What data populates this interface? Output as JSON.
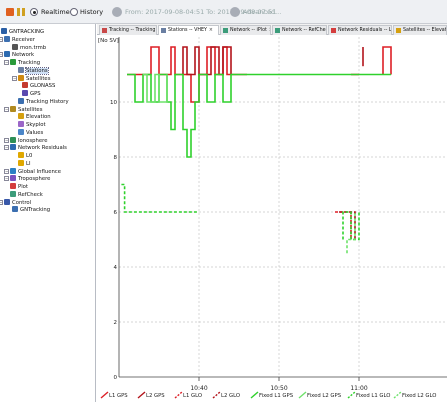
{
  "toolbar": {
    "realtime_label": "Realtime",
    "history_label": "History",
    "from_text": "From: 2017-09-08-04:51 To: 2017-09-08-07:51",
    "advanced_label": "Advanced..."
  },
  "tree": {
    "items": [
      {
        "label": "GNTRACKING",
        "icon": "app-icon"
      },
      {
        "label": "Receiver",
        "icon": "receiver-icon"
      },
      {
        "label": "mon.trmb",
        "icon": "monitor-icon"
      },
      {
        "label": "Network",
        "icon": "network-icon"
      },
      {
        "label": "Tracking",
        "icon": "tracking-icon"
      },
      {
        "label": "Stations",
        "icon": "stations-icon"
      },
      {
        "label": "Satellites",
        "icon": "satellite-icon"
      },
      {
        "label": "GLONASS",
        "icon": "glonass-icon"
      },
      {
        "label": "GPS",
        "icon": "gps-icon"
      },
      {
        "label": "Tracking History",
        "icon": "history-icon"
      },
      {
        "label": "Satellites",
        "icon": "satellite-icon"
      },
      {
        "label": "Elevation",
        "icon": "elevation-icon"
      },
      {
        "label": "Skyplot",
        "icon": "skyplot-icon"
      },
      {
        "label": "Values",
        "icon": "values-icon"
      },
      {
        "label": "Ionosphere",
        "icon": "ionosphere-icon"
      },
      {
        "label": "Network Residuals",
        "icon": "residuals-icon"
      },
      {
        "label": "L0",
        "icon": "chart-icon"
      },
      {
        "label": "LI",
        "icon": "chart-icon"
      },
      {
        "label": "Global Influence",
        "icon": "globe-icon"
      },
      {
        "label": "Troposphere",
        "icon": "troposphere-icon"
      },
      {
        "label": "Plot",
        "icon": "plot-icon"
      },
      {
        "label": "RefCheck",
        "icon": "refcheck-icon"
      },
      {
        "label": "Control",
        "icon": "control-icon"
      },
      {
        "label": "GNTracking",
        "icon": "tracking-icon"
      }
    ]
  },
  "tabs": [
    {
      "label": "Tracking -- Tracking History",
      "icon": "chart-icon"
    },
    {
      "label": "Stations -- VHEY",
      "icon": "stations-icon"
    },
    {
      "label": "Network -- iPlot",
      "icon": "plot-icon"
    },
    {
      "label": "Network -- RefCheck",
      "icon": "refcheck-icon"
    },
    {
      "label": "Network Residuals -- LO",
      "icon": "chart-icon"
    },
    {
      "label": "Satellites -- Elevation",
      "icon": "elevation-icon"
    }
  ],
  "colors": {
    "red": "#dd1f26",
    "green": "#2fd12c",
    "dark_red": "#b3141b",
    "grid": "#c7c7c7"
  },
  "chart_data": {
    "type": "line",
    "ylabel": "[No SV]",
    "ylim": [
      0,
      12
    ],
    "yticks": [
      0,
      2,
      4,
      6,
      8,
      10
    ],
    "x_range": [
      "10:30",
      "11:11"
    ],
    "x_ticks": [
      "10:40",
      "10:50",
      "11:00"
    ],
    "series": [
      {
        "name": "L1 GPS",
        "style": "solid",
        "color": "#dd1f26",
        "segments": [
          [
            [
              "10:31",
              11
            ],
            [
              "10:34",
              11
            ],
            [
              "10:34",
              12
            ],
            [
              "10:35",
              12
            ],
            [
              "10:35",
              11
            ],
            [
              "10:36.5",
              11
            ],
            [
              "10:36.5",
              12
            ],
            [
              "10:37",
              12
            ],
            [
              "10:37",
              11
            ],
            [
              "10:39",
              11
            ],
            [
              "10:39",
              10
            ],
            [
              "10:40",
              10
            ],
            [
              "10:40",
              11
            ],
            [
              "10:41",
              11
            ],
            [
              "10:41",
              12
            ],
            [
              "10:42",
              12
            ],
            [
              "10:42",
              11
            ],
            [
              "10:43",
              11
            ],
            [
              "10:43",
              12
            ],
            [
              "10:43.5",
              12
            ],
            [
              "10:43.5",
              11
            ],
            [
              "10:46",
              11
            ]
          ],
          [
            [
              "10:59",
              11
            ],
            [
              "11:00",
              11
            ]
          ],
          [
            [
              "11:03",
              11
            ],
            [
              "11:03",
              12
            ],
            [
              "11:04",
              12
            ],
            [
              "11:04",
              11
            ]
          ]
        ]
      },
      {
        "name": "L2 GPS",
        "style": "solid",
        "color": "#b3141b",
        "segments": [
          [
            [
              "10:38",
              11
            ],
            [
              "10:38",
              12
            ],
            [
              "10:38.5",
              12
            ],
            [
              "10:38.5",
              11
            ],
            [
              "10:39.5",
              11
            ],
            [
              "10:39.5",
              12
            ],
            [
              "10:40",
              12
            ],
            [
              "10:40",
              11
            ],
            [
              "10:41.5",
              11
            ],
            [
              "10:41.5",
              12
            ],
            [
              "10:42.5",
              12
            ],
            [
              "10:42.5",
              11
            ],
            [
              "10:43",
              11
            ],
            [
              "10:43",
              12
            ],
            [
              "10:44",
              12
            ],
            [
              "10:44",
              11
            ]
          ],
          [
            [
              "11:00.5",
              12
            ],
            [
              "11:00.5",
              11.3
            ]
          ]
        ]
      },
      {
        "name": "L1 GLO",
        "style": "dashed",
        "color": "#dd1f26",
        "segments": [
          [
            [
              "10:57",
              6
            ],
            [
              "10:59",
              6
            ],
            [
              "10:59",
              5
            ],
            [
              "10:59",
              6
            ]
          ]
        ]
      },
      {
        "name": "L2 GLO",
        "style": "dashed",
        "color": "#b3141b",
        "segments": [
          [
            [
              "10:57.5",
              6
            ],
            [
              "10:59.5",
              6
            ],
            [
              "10:59.5",
              5
            ]
          ]
        ]
      },
      {
        "name": "Fixed L1 GPS",
        "style": "solid",
        "color": "#2fd12c",
        "segments": [
          [
            [
              "10:31",
              11
            ],
            [
              "10:32",
              11
            ],
            [
              "10:32",
              10
            ],
            [
              "10:33",
              10
            ],
            [
              "10:33",
              11
            ],
            [
              "10:34",
              11
            ],
            [
              "10:34",
              10
            ],
            [
              "10:35",
              10
            ],
            [
              "10:35",
              11
            ],
            [
              "10:36",
              11
            ],
            [
              "10:36",
              10
            ],
            [
              "10:36.5",
              10
            ],
            [
              "10:36.5",
              9
            ],
            [
              "10:37",
              9
            ],
            [
              "10:37",
              11
            ],
            [
              "10:38",
              11
            ],
            [
              "10:38",
              9
            ],
            [
              "10:38.5",
              9
            ],
            [
              "10:38.5",
              8
            ],
            [
              "10:39",
              8
            ],
            [
              "10:39",
              9
            ],
            [
              "10:39.5",
              9
            ],
            [
              "10:39.5",
              10
            ],
            [
              "10:40",
              10
            ],
            [
              "10:40",
              11
            ],
            [
              "10:41",
              11
            ],
            [
              "10:41",
              10
            ],
            [
              "10:42",
              10
            ],
            [
              "10:42",
              11
            ],
            [
              "10:43",
              11
            ],
            [
              "10:43",
              10
            ],
            [
              "10:44",
              10
            ],
            [
              "10:44",
              11
            ],
            [
              "11:04",
              11
            ]
          ]
        ]
      },
      {
        "name": "Fixed L2 GPS",
        "style": "solid",
        "color": "#6ee26b",
        "segments": [
          [
            [
              "10:33",
              11
            ],
            [
              "10:33.5",
              11
            ],
            [
              "10:33.5",
              10
            ],
            [
              "10:34.5",
              10
            ],
            [
              "10:34.5",
              11
            ],
            [
              "10:35",
              11
            ],
            [
              "10:35",
              10
            ],
            [
              "10:36",
              10
            ],
            [
              "10:36",
              11
            ]
          ]
        ]
      },
      {
        "name": "Fixed L1 GLO",
        "style": "dashed",
        "color": "#2fd12c",
        "segments": [
          [
            [
              "10:30.3",
              7
            ],
            [
              "10:30.7",
              7
            ],
            [
              "10:30.7",
              6
            ],
            [
              "10:40",
              6
            ]
          ],
          [
            [
              "10:58",
              5
            ],
            [
              "10:58",
              6
            ],
            [
              "10:59",
              6
            ],
            [
              "10:59",
              5
            ],
            [
              "11:00",
              5
            ],
            [
              "11:00",
              6
            ]
          ]
        ]
      },
      {
        "name": "Fixed L2 GLO",
        "style": "dashed",
        "color": "#6ee26b",
        "segments": [
          [
            [
              "10:58.5",
              4.5
            ],
            [
              "10:58.5",
              5
            ],
            [
              "10:59.5",
              5
            ],
            [
              "10:59.5",
              6
            ]
          ]
        ]
      }
    ]
  }
}
